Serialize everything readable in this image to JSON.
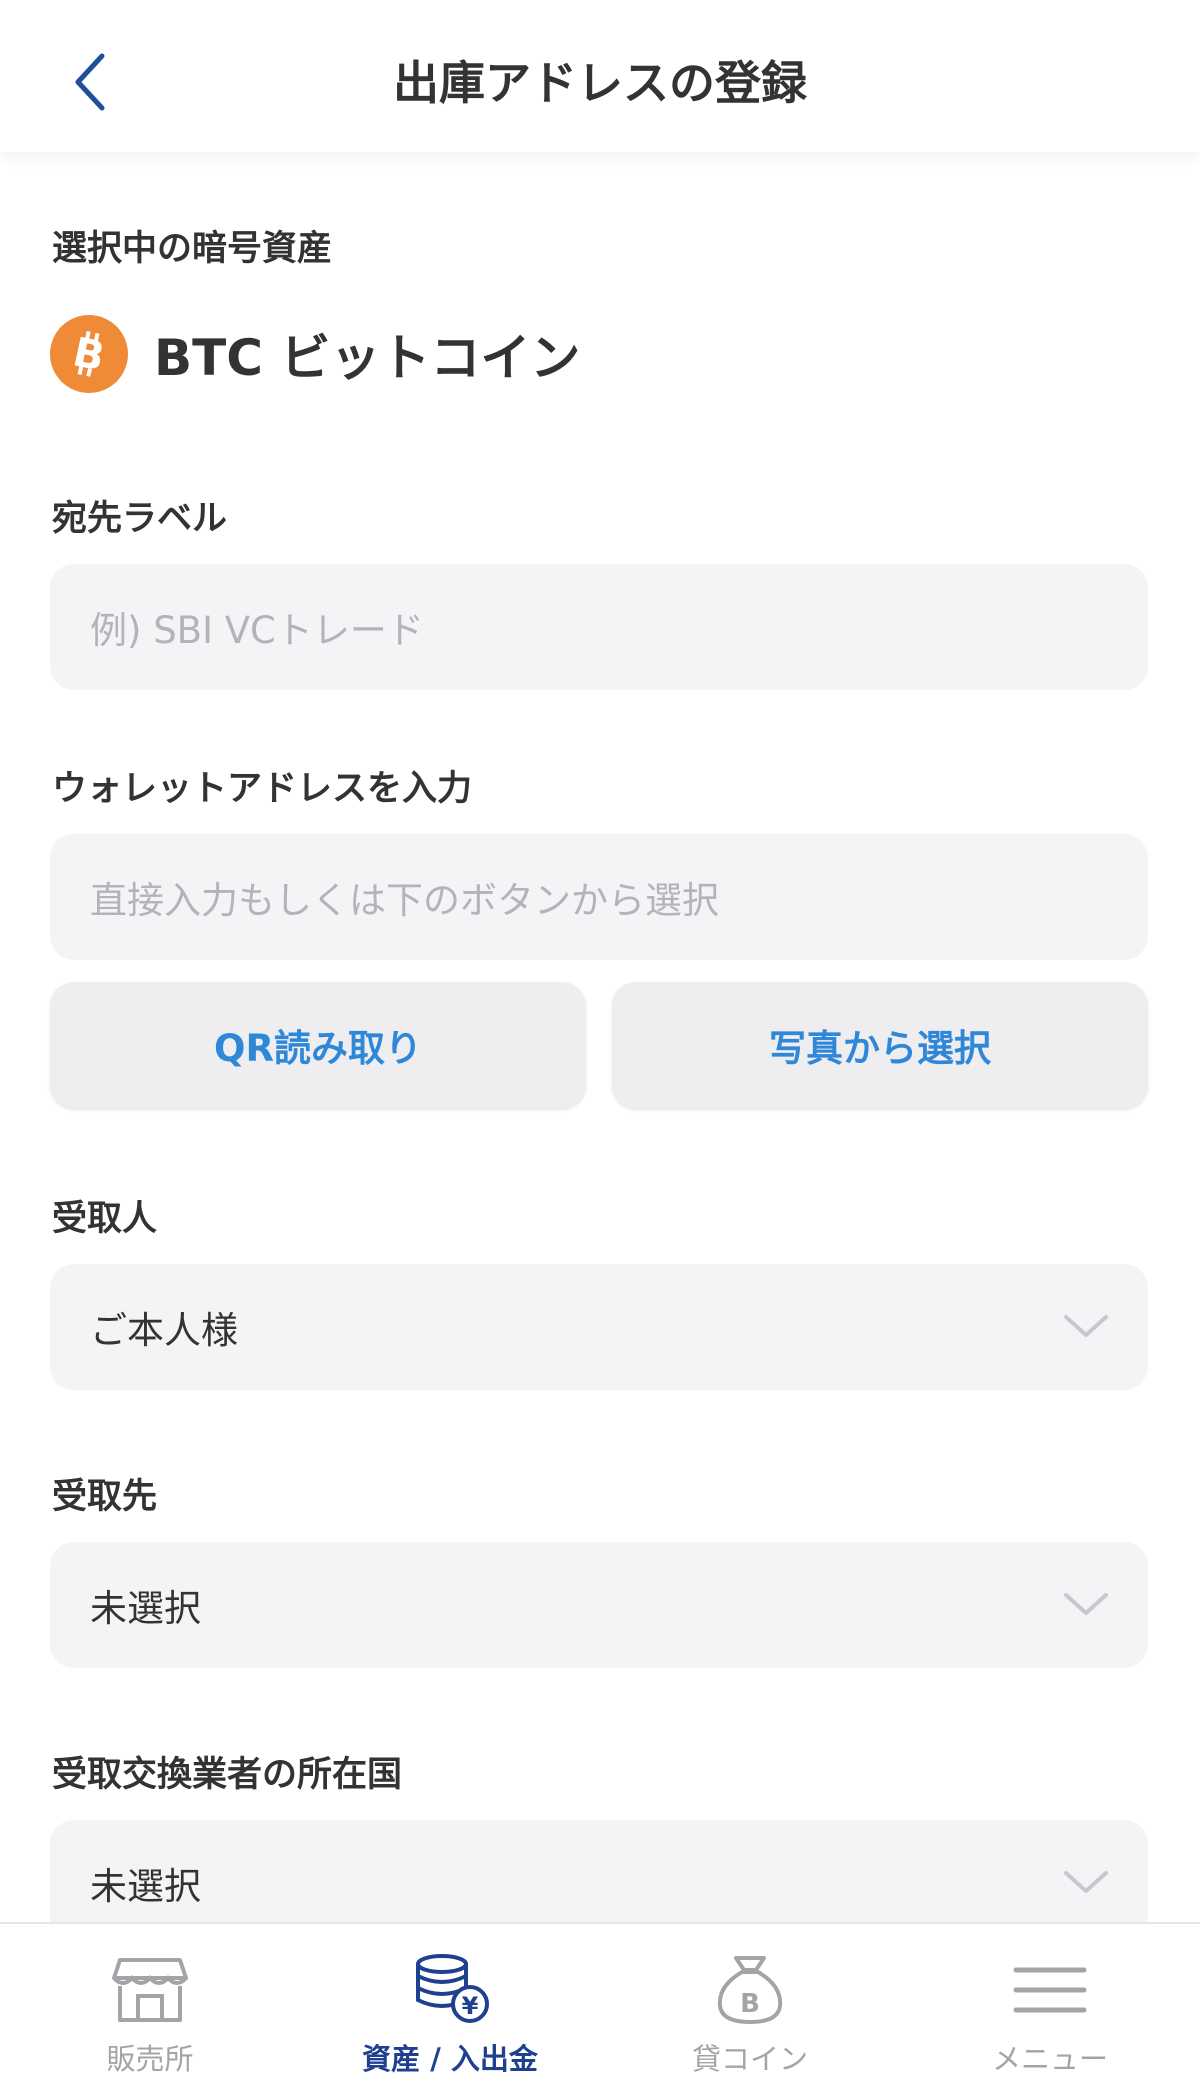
{
  "header": {
    "title": "出庫アドレスの登録"
  },
  "asset": {
    "section_label": "選択中の暗号資産",
    "name": "BTC ビットコイン",
    "icon": "bitcoin-icon"
  },
  "label_field": {
    "label": "宛先ラベル",
    "placeholder": "例) SBI VCトレード"
  },
  "address_field": {
    "label": "ウォレットアドレスを入力",
    "placeholder": "直接入力もしくは下のボタンから選択"
  },
  "buttons": {
    "qr": "QR読み取り",
    "photo": "写真から選択"
  },
  "recipient": {
    "label": "受取人",
    "value": "ご本人様"
  },
  "destination": {
    "label": "受取先",
    "value": "未選択"
  },
  "exchange_country": {
    "label": "受取交換業者の所在国",
    "value": "未選択"
  },
  "nav": {
    "items": [
      {
        "label": "販売所",
        "icon": "store-icon",
        "active": false
      },
      {
        "label": "資産 / 入出金",
        "icon": "assets-coins-icon",
        "active": true
      },
      {
        "label": "貸コイン",
        "icon": "coin-bag-icon",
        "active": false
      },
      {
        "label": "メニュー",
        "icon": "menu-icon",
        "active": false
      }
    ]
  },
  "colors": {
    "accent_blue": "#2f87d8",
    "nav_active": "#1f3f8f",
    "back_arrow": "#1f4e9c",
    "bitcoin_orange": "#ef8a36",
    "field_bg": "#f4f4f6",
    "nav_inactive": "#a4a4a8"
  }
}
